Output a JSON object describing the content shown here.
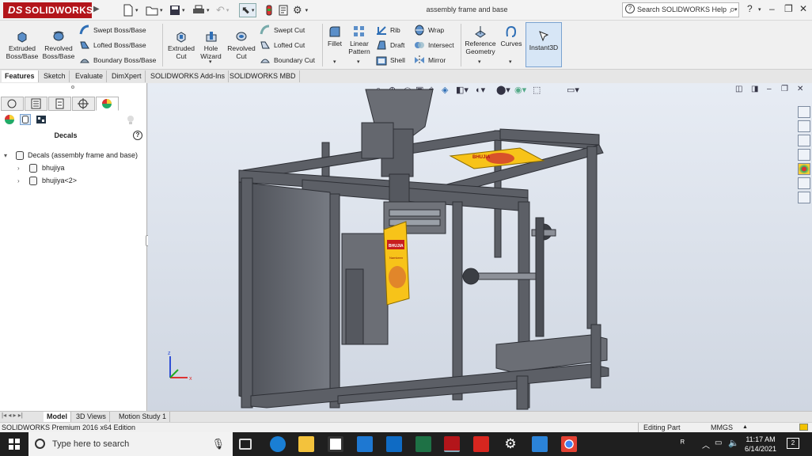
{
  "app": {
    "brand": "SOLIDWORKS",
    "brand_prefix": "DS",
    "doc_title": "assembly frame and base",
    "search_placeholder": "Search SOLIDWORKS Help"
  },
  "ribbon": {
    "extruded_boss": [
      "Extruded",
      "Boss/Base"
    ],
    "revolved_boss": [
      "Revolved",
      "Boss/Base"
    ],
    "swept_boss": "Swept Boss/Base",
    "lofted_boss": "Lofted Boss/Base",
    "boundary_boss": "Boundary Boss/Base",
    "extruded_cut": [
      "Extruded",
      "Cut"
    ],
    "hole_wizard": [
      "Hole",
      "Wizard"
    ],
    "revolved_cut": [
      "Revolved",
      "Cut"
    ],
    "swept_cut": "Swept Cut",
    "lofted_cut": "Lofted Cut",
    "boundary_cut": "Boundary Cut",
    "fillet": "Fillet",
    "linear_pattern": [
      "Linear",
      "Pattern"
    ],
    "rib": "Rib",
    "draft": "Draft",
    "shell": "Shell",
    "wrap": "Wrap",
    "intersect": "Intersect",
    "mirror": "Mirror",
    "reference_geometry": [
      "Reference",
      "Geometry"
    ],
    "curves": "Curves",
    "instant3d": "Instant3D"
  },
  "tabs": [
    "Features",
    "Sketch",
    "Evaluate",
    "DimXpert",
    "SOLIDWORKS Add-Ins",
    "SOLIDWORKS MBD"
  ],
  "panel": {
    "title": "Decals",
    "tree_root": "Decals (assembly frame and base)",
    "items": [
      "bhujiya",
      "bhujiya<2>"
    ]
  },
  "decal": {
    "brand": "BHUJIA",
    "sub": "Namkeen"
  },
  "bottom_tabs": [
    "Model",
    "3D Views",
    "Motion Study 1"
  ],
  "status": {
    "left": "SOLIDWORKS Premium 2016 x64 Edition",
    "mode": "Editing Part",
    "units": "MMGS"
  },
  "taskbar": {
    "search": "Type here to search",
    "time": "11:17 AM",
    "date": "6/14/2021",
    "notif_count": "2"
  },
  "colors": {
    "brand_red": "#b3151a",
    "frame": "#5c5f66",
    "accent_blue": "#2f6fb6"
  }
}
